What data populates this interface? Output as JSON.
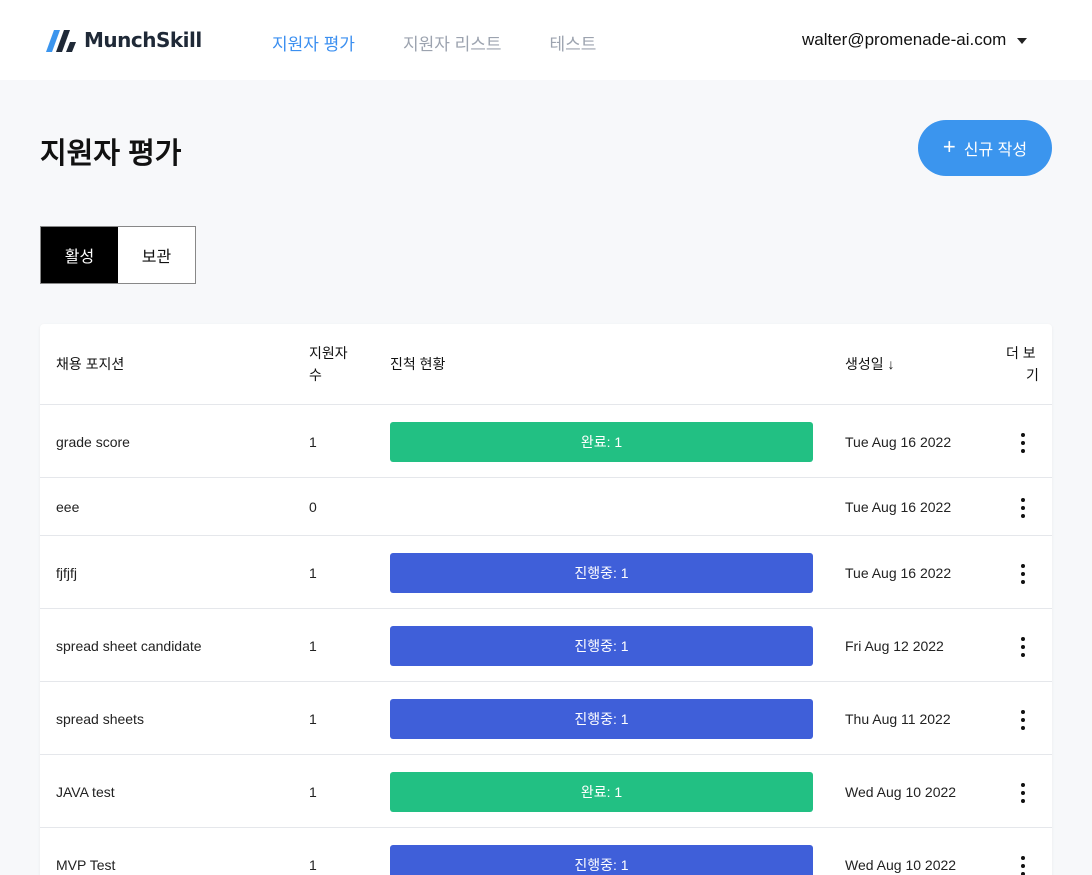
{
  "brand": {
    "name": "MunchSkill"
  },
  "nav": [
    {
      "label": "지원자 평가",
      "active": true
    },
    {
      "label": "지원자 리스트",
      "active": false
    },
    {
      "label": "테스트",
      "active": false
    }
  ],
  "user": {
    "email": "walter@promenade-ai.com"
  },
  "page": {
    "title": "지원자 평가",
    "new_button": "신규 작성"
  },
  "tabs": [
    {
      "label": "활성",
      "active": true
    },
    {
      "label": "보관",
      "active": false
    }
  ],
  "table": {
    "headers": {
      "position": "채용 포지션",
      "count_line1": "지원자",
      "count_line2": "수",
      "progress": "진척 현황",
      "created": "생성일 ↓",
      "more_line1": "더 보",
      "more_line2": "기"
    },
    "rows": [
      {
        "position": "grade score",
        "count": "1",
        "status": "완료: 1",
        "status_type": "done",
        "created": "Tue Aug 16 2022"
      },
      {
        "position": "eee",
        "count": "0",
        "status": "",
        "status_type": "none",
        "created": "Tue Aug 16 2022"
      },
      {
        "position": "fjfjfj",
        "count": "1",
        "status": "진행중: 1",
        "status_type": "progress",
        "created": "Tue Aug 16 2022"
      },
      {
        "position": "spread sheet candidate",
        "count": "1",
        "status": "진행중: 1",
        "status_type": "progress",
        "created": "Fri Aug 12 2022"
      },
      {
        "position": "spread sheets",
        "count": "1",
        "status": "진행중: 1",
        "status_type": "progress",
        "created": "Thu Aug 11 2022"
      },
      {
        "position": "JAVA test",
        "count": "1",
        "status": "완료: 1",
        "status_type": "done",
        "created": "Wed Aug 10 2022"
      },
      {
        "position": "MVP Test",
        "count": "1",
        "status": "진행중: 1",
        "status_type": "progress",
        "created": "Wed Aug 10 2022"
      }
    ]
  },
  "colors": {
    "accent": "#3b95ee",
    "done": "#22c083",
    "progress": "#3f5fd9"
  }
}
